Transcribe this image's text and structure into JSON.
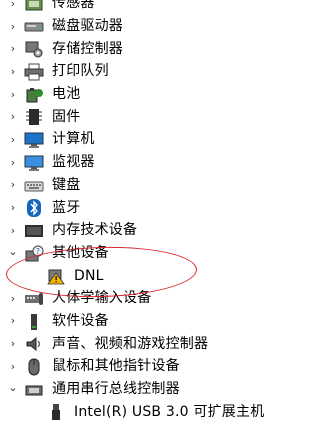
{
  "device_tree": {
    "items": [
      {
        "label": "传感器",
        "expanded": false,
        "icon": "sensor-icon"
      },
      {
        "label": "磁盘驱动器",
        "expanded": false,
        "icon": "disk-drive-icon"
      },
      {
        "label": "存储控制器",
        "expanded": false,
        "icon": "storage-controller-icon"
      },
      {
        "label": "打印队列",
        "expanded": false,
        "icon": "printer-icon"
      },
      {
        "label": "电池",
        "expanded": false,
        "icon": "battery-icon"
      },
      {
        "label": "固件",
        "expanded": false,
        "icon": "firmware-icon"
      },
      {
        "label": "计算机",
        "expanded": false,
        "icon": "computer-icon"
      },
      {
        "label": "监视器",
        "expanded": false,
        "icon": "monitor-icon"
      },
      {
        "label": "键盘",
        "expanded": false,
        "icon": "keyboard-icon"
      },
      {
        "label": "蓝牙",
        "expanded": false,
        "icon": "bluetooth-icon"
      },
      {
        "label": "内存技术设备",
        "expanded": false,
        "icon": "memory-device-icon"
      },
      {
        "label": "其他设备",
        "expanded": true,
        "icon": "other-devices-icon",
        "children": [
          {
            "label": "DNL",
            "icon": "warning-device-icon"
          }
        ]
      },
      {
        "label": "人体学输入设备",
        "expanded": false,
        "icon": "hid-icon"
      },
      {
        "label": "软件设备",
        "expanded": false,
        "icon": "software-device-icon"
      },
      {
        "label": "声音、视频和游戏控制器",
        "expanded": false,
        "icon": "audio-icon"
      },
      {
        "label": "鼠标和其他指针设备",
        "expanded": false,
        "icon": "mouse-icon"
      },
      {
        "label": "通用串行总线控制器",
        "expanded": true,
        "icon": "usb-icon",
        "children": [
          {
            "label": "Intel(R) USB 3.0 可扩展主机",
            "icon": "usb-plug-icon"
          }
        ]
      }
    ]
  },
  "glyphs": {
    "collapsed": "›",
    "expanded": "⌄"
  },
  "colors": {
    "annotation_oval": "#d9272d",
    "warning": "#f2b600"
  }
}
